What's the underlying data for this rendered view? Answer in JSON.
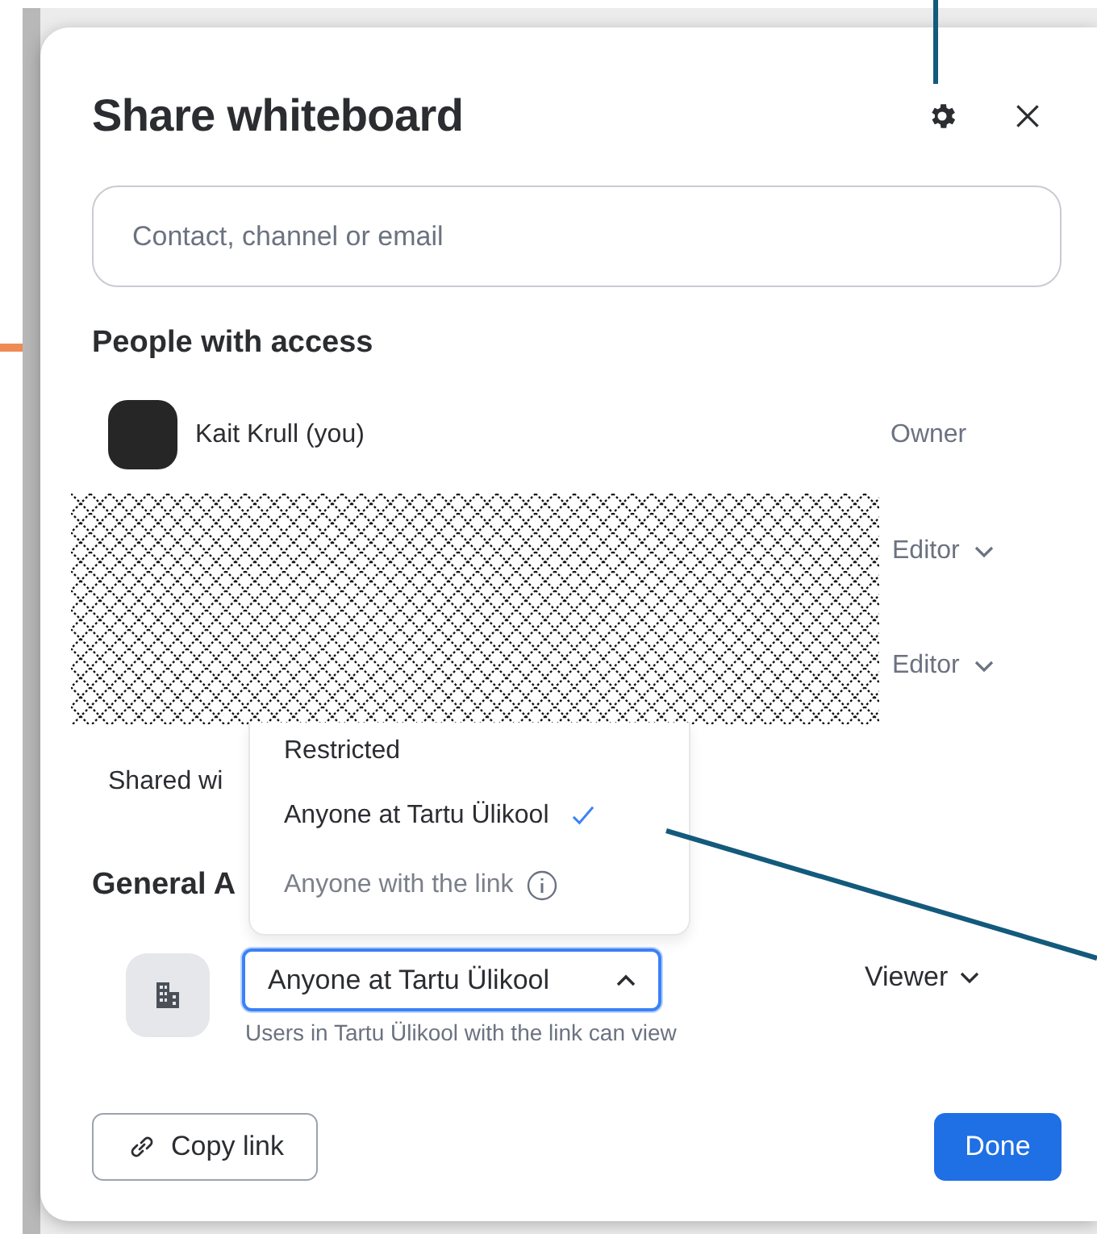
{
  "dialog": {
    "title": "Share whiteboard",
    "search": {
      "placeholder": "Contact, channel or email"
    },
    "people_heading": "People with access",
    "people": [
      {
        "name": "Kait Krull (you)",
        "role": "Owner",
        "has_menu": false
      }
    ],
    "redacted_people": [
      {
        "role": "Editor",
        "has_menu": true
      },
      {
        "role": "Editor",
        "has_menu": true
      }
    ],
    "shared_with_label": "Shared wi",
    "general_access_heading": "General A",
    "access_select": {
      "value": "Anyone at Tartu Ülikool",
      "expanded": true
    },
    "access_menu": [
      {
        "label": "Restricted",
        "selected": false,
        "disabled": false,
        "info": false
      },
      {
        "label": "Anyone at Tartu Ülikool",
        "selected": true,
        "disabled": false,
        "info": false
      },
      {
        "label": "Anyone with the link",
        "selected": false,
        "disabled": true,
        "info": true
      }
    ],
    "access_hint": "Users in Tartu Ülikool with the link can view",
    "role_select": "Viewer",
    "copy_link_button": "Copy link",
    "done_button": "Done"
  }
}
